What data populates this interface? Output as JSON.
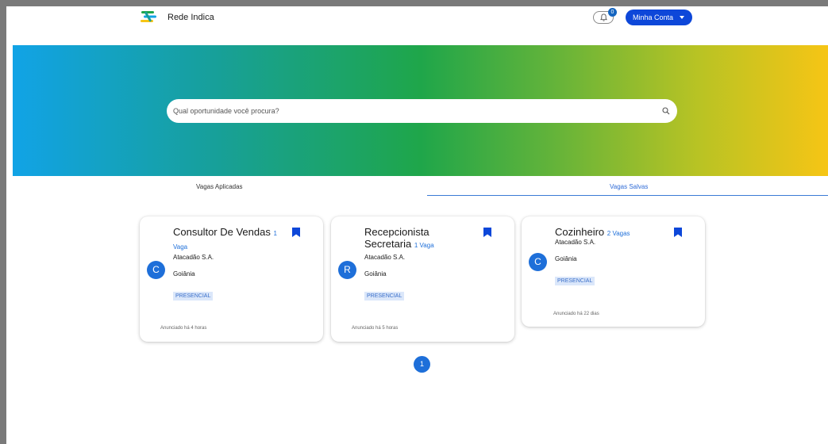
{
  "header": {
    "brand": "Rede Indica",
    "notifications_count": "0",
    "account_label": "Minha Conta"
  },
  "search": {
    "placeholder": "Qual oportunidade você procura?"
  },
  "tabs": [
    {
      "label": "Vagas Aplicadas",
      "active": false
    },
    {
      "label": "Vagas Salvas",
      "active": true
    }
  ],
  "jobs": [
    {
      "title": "Consultor De Vendas",
      "vagas": "1 Vaga",
      "company": "Atacadão S.A.",
      "avatar": "C",
      "city": "Goiânia",
      "mode": "PRESENCIAL",
      "announced": "Anunciado há 4 horas"
    },
    {
      "title": "Recepcionista Secretaria",
      "vagas": "1 Vaga",
      "company": "Atacadão S.A.",
      "avatar": "R",
      "city": "Goiânia",
      "mode": "PRESENCIAL",
      "announced": "Anunciado há 5 horas"
    },
    {
      "title": "Cozinheiro",
      "vagas": "2 Vagas",
      "company": "Atacadão S.A.",
      "avatar": "C",
      "city": "Goiânia",
      "mode": "PRESENCIAL",
      "announced": "Anunciado há 22 dias"
    }
  ],
  "pagination": {
    "current": "1"
  },
  "colors": {
    "primary": "#1e6fd9",
    "button": "#0d47d9",
    "chip_bg": "#dbe7fa",
    "gradient_start": "#11a3e6",
    "gradient_mid": "#1fa64a",
    "gradient_end": "#f6c515"
  },
  "icons": {
    "logo": "logo-icon",
    "bell": "bell-icon",
    "search": "search-icon",
    "bookmark": "bookmark-icon",
    "caret": "chevron-down-icon"
  }
}
